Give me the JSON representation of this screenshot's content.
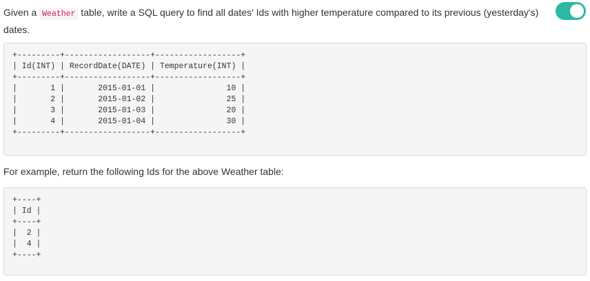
{
  "description": {
    "prefix": "Given a ",
    "table_name": "Weather",
    "suffix": " table, write a SQL query to find all dates' Ids with higher temperature compared to its previous (yesterday's) dates."
  },
  "toggle": {
    "state": "on",
    "color": "#2eb8a5"
  },
  "weather_table_ascii": "+---------+------------------+------------------+\n| Id(INT) | RecordDate(DATE) | Temperature(INT) |\n+---------+------------------+------------------+\n|       1 |       2015-01-01 |               10 |\n|       2 |       2015-01-02 |               25 |\n|       3 |       2015-01-03 |               20 |\n|       4 |       2015-01-04 |               30 |\n+---------+------------------+------------------+",
  "example_text": "For example, return the following Ids for the above Weather table:",
  "result_table_ascii": "+----+\n| Id |\n+----+\n|  2 |\n|  4 |\n+----+"
}
